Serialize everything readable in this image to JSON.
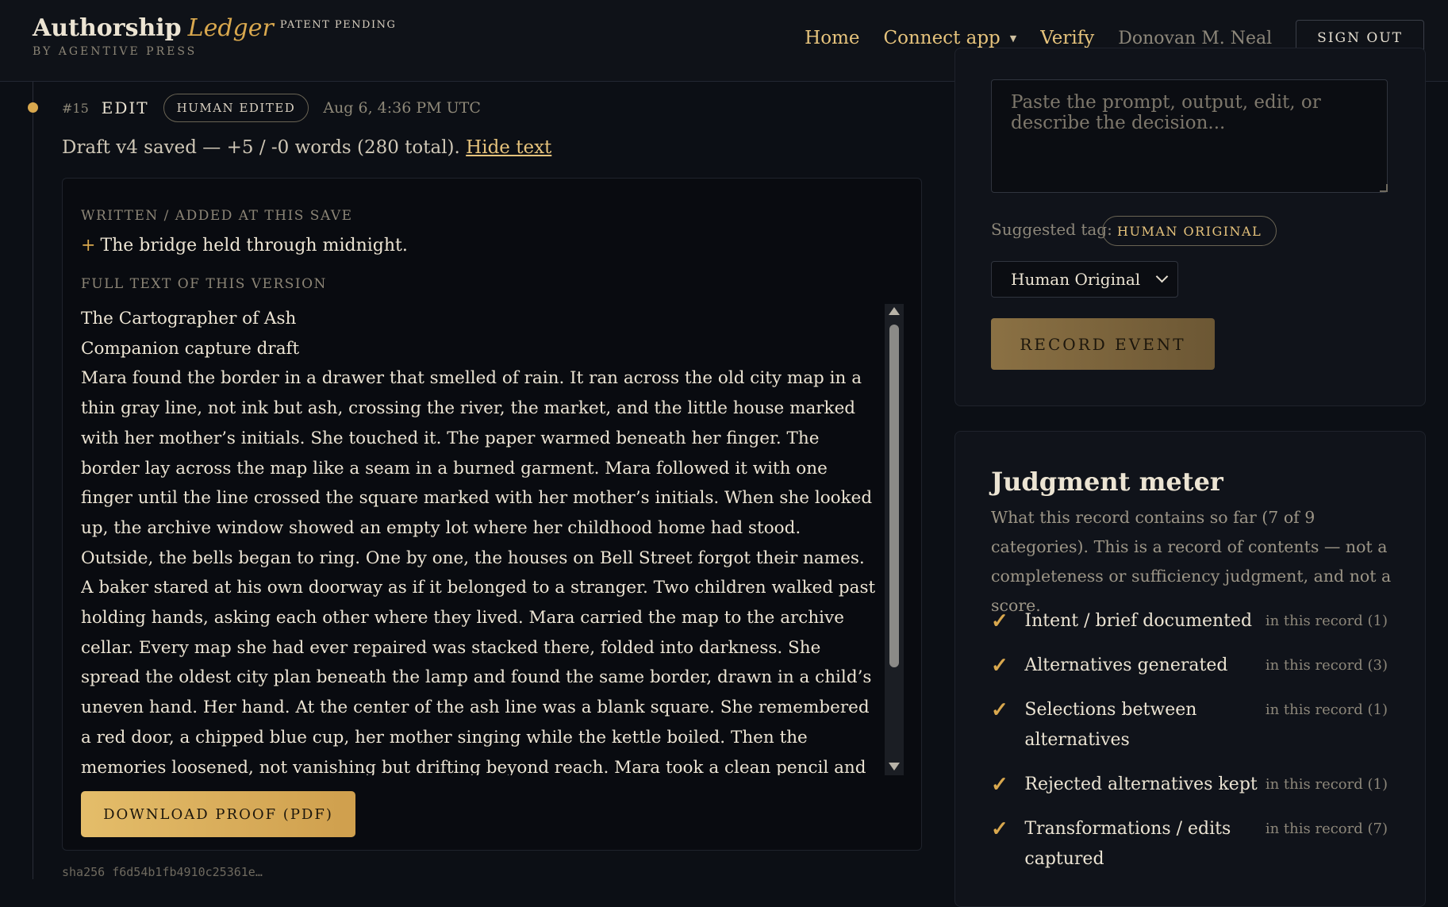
{
  "header": {
    "brand_main": "Authorship",
    "brand_em": "Ledger",
    "patent": "PATENT PENDING",
    "subtitle": "BY AGENTIVE PRESS",
    "nav": {
      "home": "Home",
      "connect": "Connect app",
      "verify": "Verify",
      "user": "Donovan M. Neal",
      "signout": "SIGN OUT"
    }
  },
  "event": {
    "number": "#15",
    "type": "EDIT",
    "badge": "HUMAN EDITED",
    "time": "Aug 6, 4:36 PM UTC",
    "summary": "Draft v4 saved — +5 / -0 words (280 total).",
    "hide_link": "Hide text",
    "added_label": "WRITTEN / ADDED AT THIS SAVE",
    "added_plus": "+",
    "added_text": "The bridge held through midnight.",
    "full_label": "FULL TEXT OF THIS VERSION",
    "full_text": [
      "The Cartographer of Ash",
      "Companion capture draft",
      "Mara found the border in a drawer that smelled of rain. It ran across the old city map in a thin gray line, not ink but ash, crossing the river, the market, and the little house marked with her mother’s initials. She touched it. The paper warmed beneath her finger. The border lay across the map like a seam in a burned garment. Mara followed it with one finger until the line crossed the square marked with her mother’s initials. When she looked up, the archive window showed an empty lot where her childhood home had stood.",
      "Outside, the bells began to ring. One by one, the houses on Bell Street forgot their names. A baker stared at his own doorway as if it belonged to a stranger. Two children walked past holding hands, asking each other where they lived. Mara carried the map to the archive cellar. Every map she had ever repaired was stacked there, folded into darkness. She spread the oldest city plan beneath the lamp and found the same border, drawn in a child’s uneven hand. Her hand. At the center of the ash line was a blank square. She remembered a red door, a chipped blue cup, her mother singing while the kettle boiled. Then the memories loosened, not vanishing but drifting beyond reach. Mara took a clean pencil and drew a small bridge across the border. The city shuddered."
    ],
    "download": "DOWNLOAD PROOF (PDF)",
    "sha": "sha256 f6d54b1fb4910c25361e…"
  },
  "form": {
    "placeholder": "Paste the prompt, output, edit, or describe the decision...",
    "suggested_label": "Suggested tag:",
    "suggested_tag": "HUMAN ORIGINAL",
    "select_value": "Human Original",
    "record_button": "RECORD EVENT"
  },
  "meter": {
    "title": "Judgment meter",
    "desc": "What this record contains so far (7 of 9 categories). This is a record of contents — not a completeness or sufficiency judgment, and not a score.",
    "check_glyph": "✓",
    "items": [
      {
        "label": "Intent / brief documented",
        "count": "in this record (1)"
      },
      {
        "label": "Alternatives generated",
        "count": "in this record (3)"
      },
      {
        "label": "Selections between alternatives",
        "count": "in this record (1)"
      },
      {
        "label": "Rejected alternatives kept",
        "count": "in this record (1)"
      },
      {
        "label": "Transformations / edits captured",
        "count": "in this record (7)"
      }
    ]
  },
  "colors": {
    "accent": "#d9a84e",
    "background": "#0c0f15",
    "panel": "#10131a"
  }
}
